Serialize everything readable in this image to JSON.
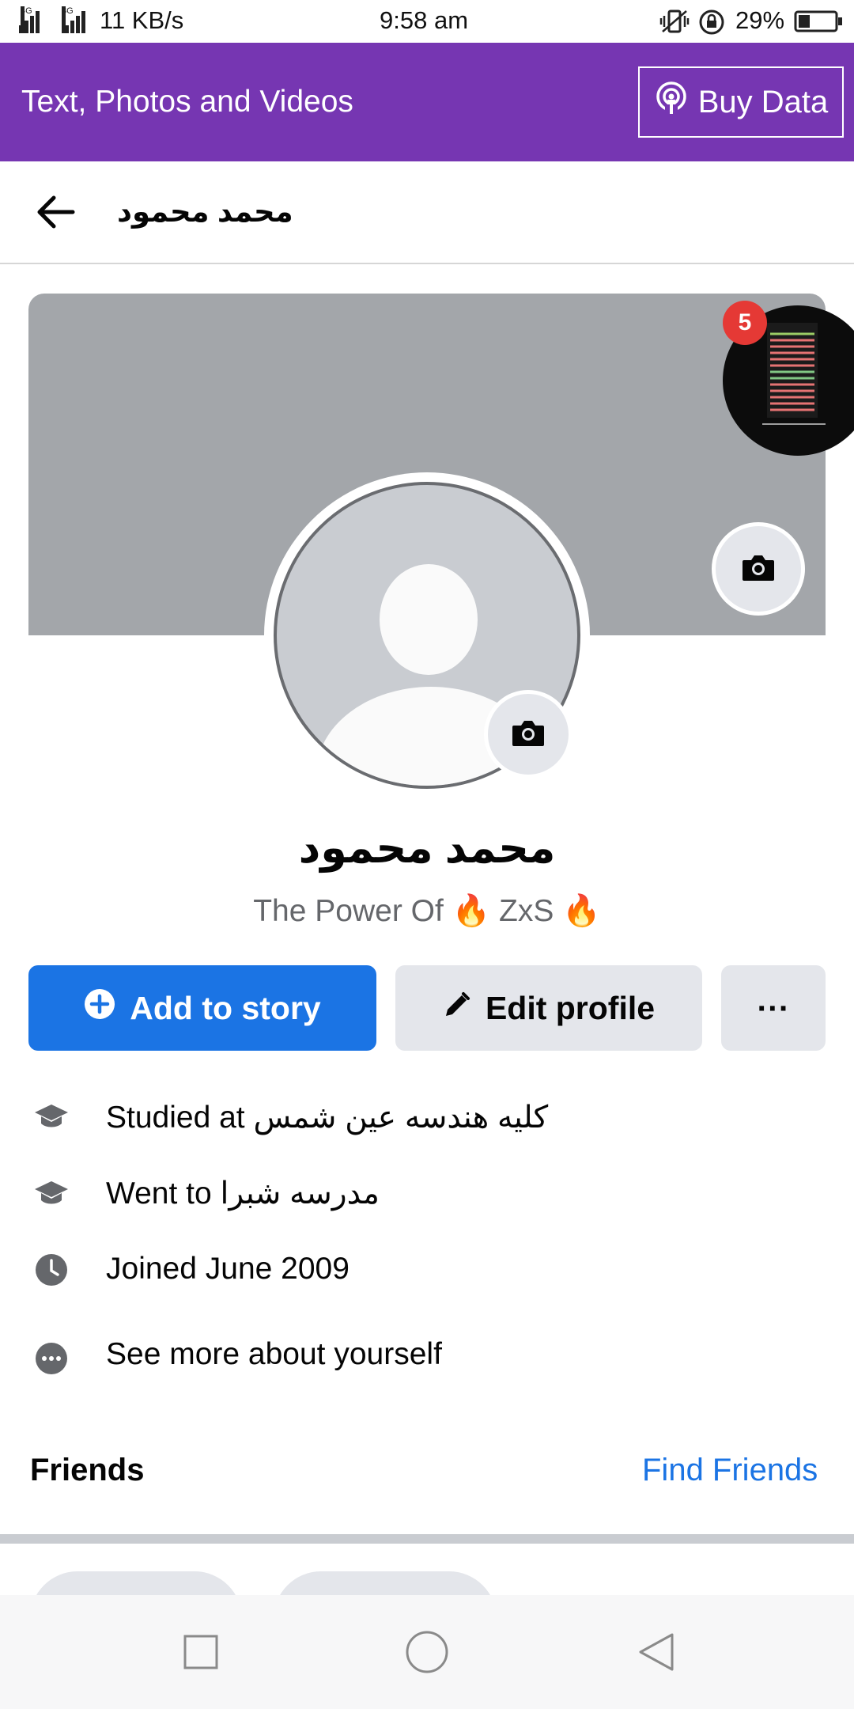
{
  "status_bar": {
    "network_1": "4G",
    "network_2": "3G",
    "speed": "11 KB/s",
    "time": "9:58 am",
    "battery": "29%"
  },
  "banner": {
    "title": "Text, Photos and Videos",
    "buy_label": "Buy Data",
    "color": "#7636b2"
  },
  "header": {
    "title": "محمد محمود"
  },
  "profile": {
    "name": "محمد محمود",
    "bio": "The Power Of 🔥 ZxS 🔥",
    "bubble_badge": "5"
  },
  "actions": {
    "add_story": "Add to story",
    "edit_profile": "Edit profile",
    "more": "···"
  },
  "info": {
    "studied": "Studied at كليه هندسه عين شمس",
    "went": "Went to مدرسه شبرا",
    "joined": "Joined June 2009",
    "see_more": "See more about yourself"
  },
  "friends": {
    "heading": "Friends",
    "find": "Find Friends"
  },
  "colors": {
    "accent": "#1b74e4",
    "button_gray": "#e4e6eb",
    "secondary_text": "#65676b"
  }
}
